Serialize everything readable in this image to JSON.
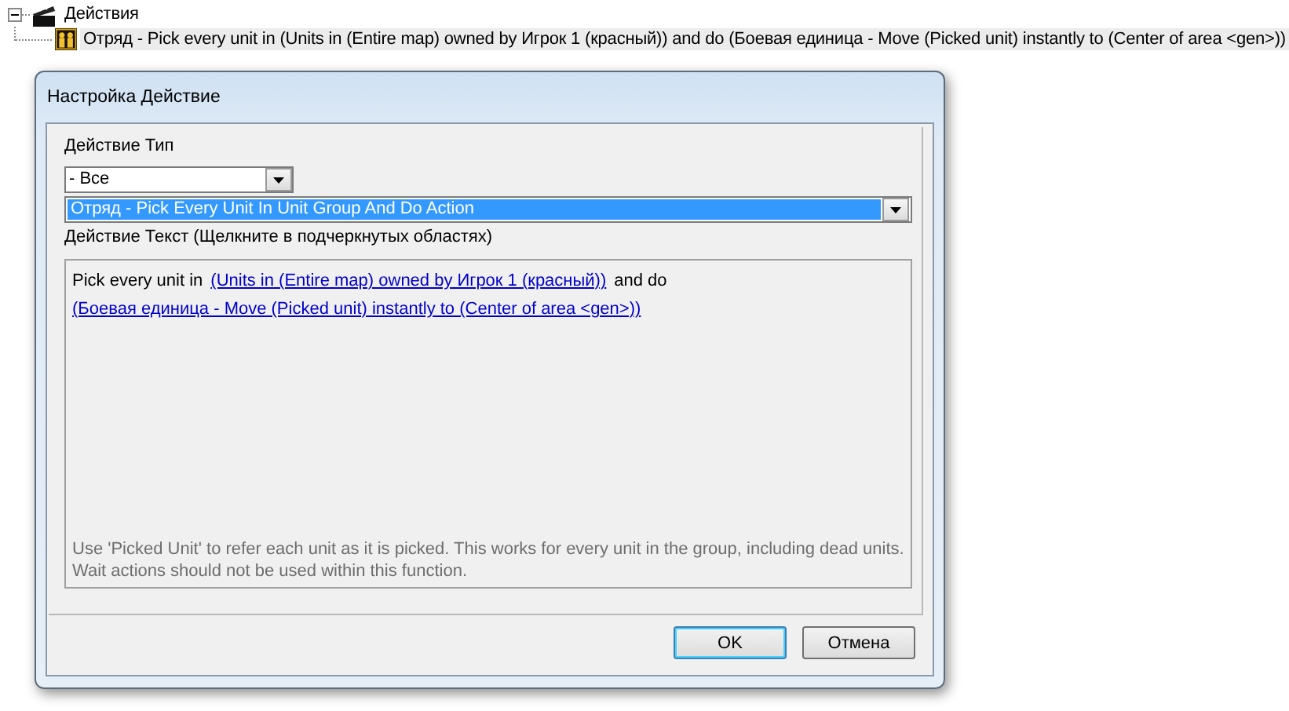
{
  "tree": {
    "label": "Действия",
    "expanded": true,
    "children": [
      {
        "label": "Отряд - Pick every unit in (Units in (Entire map) owned by Игрок 1 (красный)) and do (Боевая единица - Move (Picked unit) instantly to (Center of area <gen>))",
        "selected": true
      }
    ]
  },
  "dialog": {
    "title": "Настройка Действие",
    "type_label": "Действие Тип",
    "type_dropdown": {
      "value": "- Все"
    },
    "action_dropdown": {
      "value": "Отряд - Pick Every Unit In Unit Group And Do Action"
    },
    "text_label": "Действие Текст (Щелкните в подчеркнутых областях)",
    "action_text": [
      {
        "kind": "text",
        "text": "Pick every unit in"
      },
      {
        "kind": "link",
        "text": "(Units in (Entire map) owned by Игрок 1 (красный))"
      },
      {
        "kind": "text",
        "text": "and do"
      },
      {
        "kind": "break"
      },
      {
        "kind": "link",
        "text": "(Боевая единица - Move (Picked unit) instantly to (Center of area <gen>))"
      }
    ],
    "hint": [
      "Use 'Picked Unit' to refer each unit as it is picked.  This works for every unit in the group, including dead units.",
      "Wait actions should not be used within this function."
    ],
    "buttons": [
      "OK",
      "Отмена"
    ]
  }
}
